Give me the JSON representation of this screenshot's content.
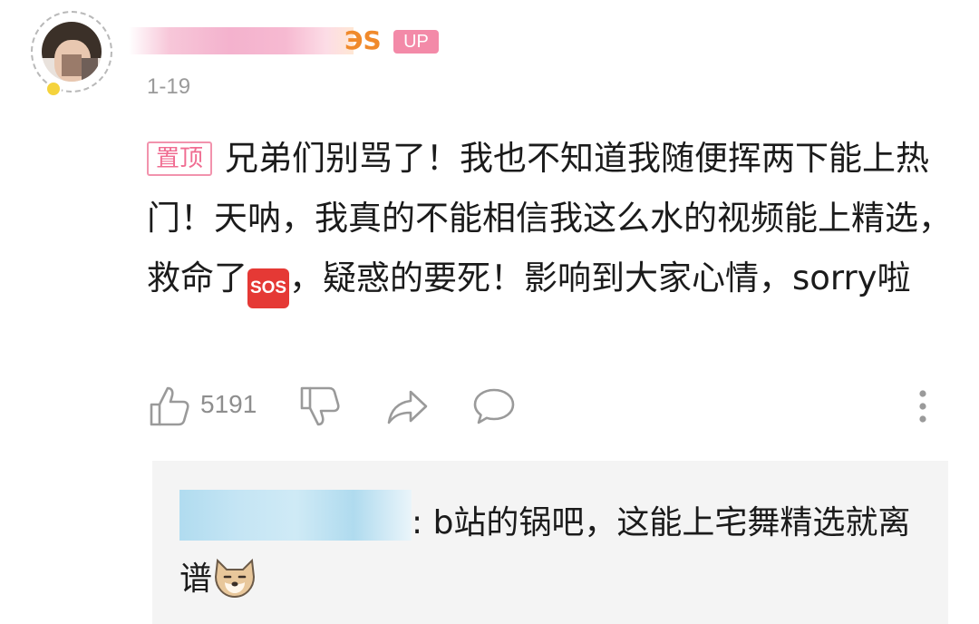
{
  "comment": {
    "username_tail": "ЭS",
    "up_badge": "UP",
    "date": "1-19",
    "pin_tag": "置顶",
    "text_part1": "兄弟们别骂了！我也不知道我随便挥两下能上热门！天呐，我真的不能相信我这么水的视频能上精选，救命了",
    "sos_emoji": "SOS",
    "text_part2": "，疑惑的要死！影响到大家心情，sorry啦",
    "like_count": "5191"
  },
  "icons": {
    "like": "thumbs-up-icon",
    "dislike": "thumbs-down-icon",
    "share": "share-icon",
    "reply": "comment-bubble-icon",
    "more": "more-vertical-icon",
    "reply_emoji": "doge-emoji-icon"
  },
  "reply": {
    "text_part1": ": b站的锅吧，这能上宅舞精选就离谱"
  },
  "colors": {
    "pin_border": "#f293ad",
    "up_badge_bg": "#f38aa8",
    "date": "#9a9a9a",
    "reply_bg": "#f4f4f4",
    "icon": "#9a9a9a"
  }
}
